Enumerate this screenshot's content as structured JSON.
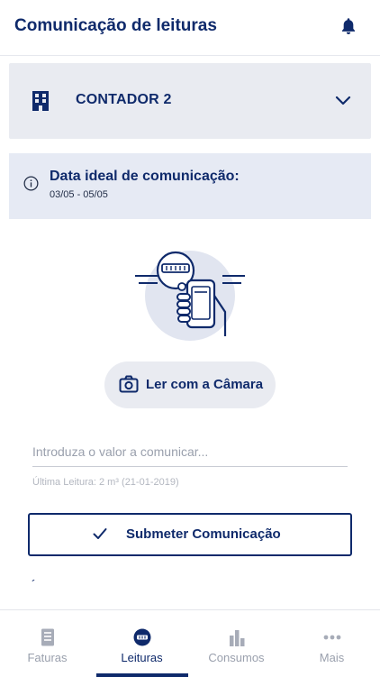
{
  "header": {
    "title": "Comunicação de leituras",
    "icon": "bell-icon"
  },
  "meter_select": {
    "label": "CONTADOR 2",
    "icon": "building-icon",
    "chevron": "chevron-down-icon"
  },
  "date_info": {
    "title": "Data ideal de comunicação:",
    "value": "03/05 - 05/05",
    "icon": "info-icon"
  },
  "camera_button": {
    "label": "Ler com a Câmara",
    "icon": "camera-icon"
  },
  "reading_input": {
    "placeholder": "Introduza o valor a comunicar...",
    "value": ""
  },
  "last_reading": "Última Leitura: 2 m³ (21-01-2019)",
  "submit_button": {
    "label": "Submeter Comunicação",
    "icon": "check-icon"
  },
  "stray_mark": "´",
  "bottom_nav": {
    "items": [
      {
        "label": "Faturas",
        "icon": "invoice-icon",
        "active": false
      },
      {
        "label": "Leituras",
        "icon": "meter-icon",
        "active": true
      },
      {
        "label": "Consumos",
        "icon": "bar-chart-icon",
        "active": false
      },
      {
        "label": "Mais",
        "icon": "more-dots-icon",
        "active": false
      }
    ]
  },
  "colors": {
    "primary": "#0f2a6b",
    "panel_bg": "#e9ebf1",
    "info_bg": "#e6eaf4",
    "muted_text": "#9aa0ad",
    "illustration_circle": "#e1e5f0"
  }
}
